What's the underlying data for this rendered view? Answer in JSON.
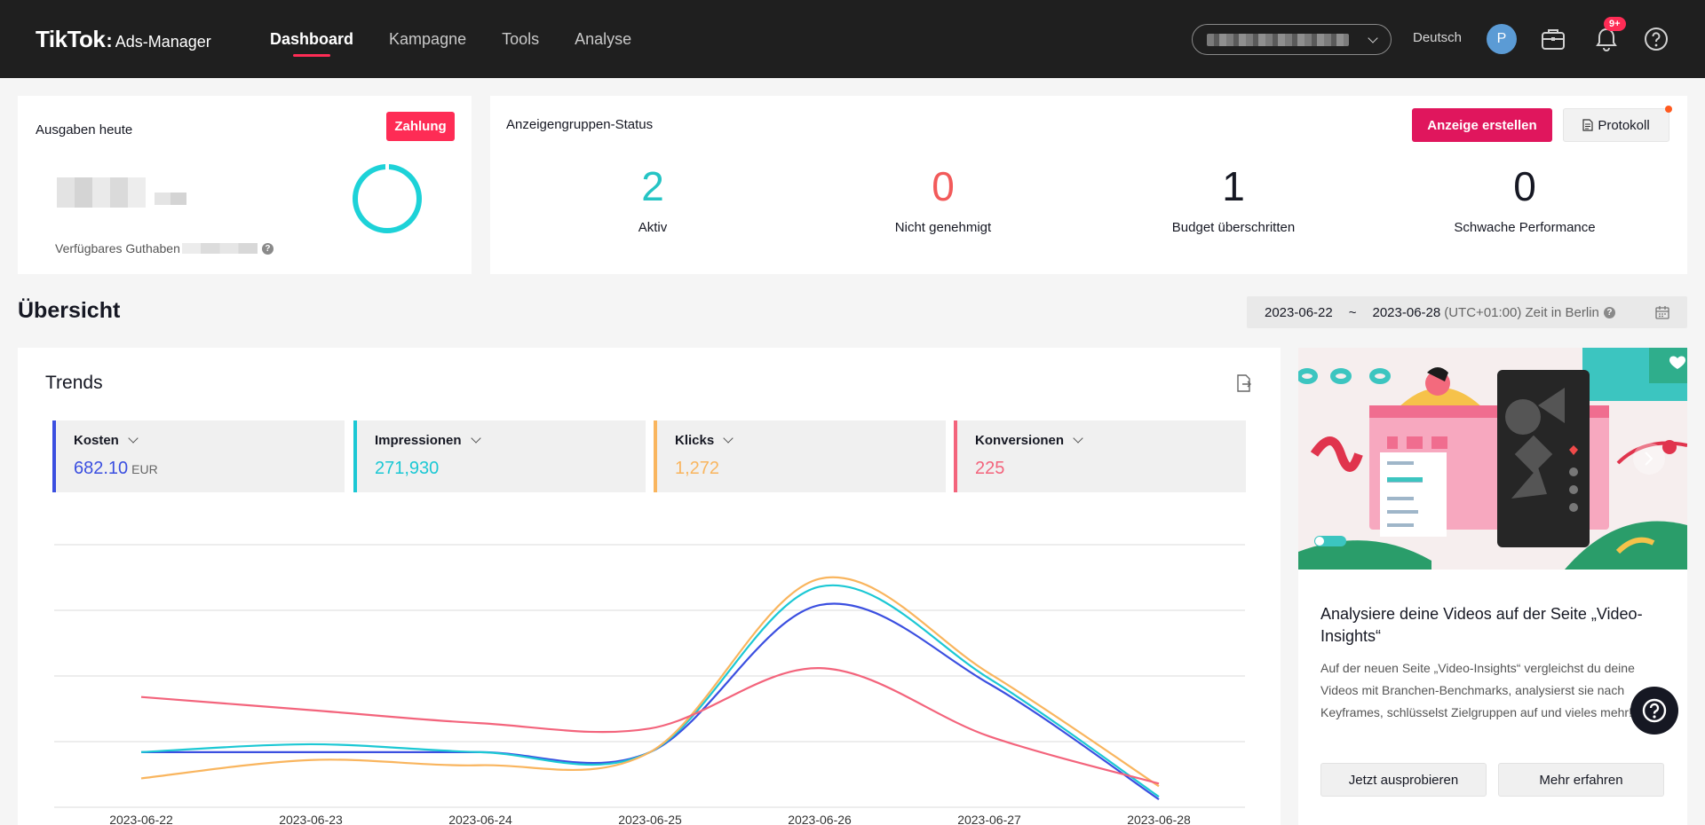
{
  "header": {
    "brand": "TikTok",
    "product": "Ads-Manager",
    "nav": [
      {
        "label": "Dashboard",
        "active": true
      },
      {
        "label": "Kampagne"
      },
      {
        "label": "Tools"
      },
      {
        "label": "Analyse"
      }
    ],
    "language": "Deutsch",
    "avatar_initial": "P",
    "notification_badge": "9+"
  },
  "spend": {
    "title": "Ausgaben heute",
    "pay_label": "Zahlung",
    "balance_label": "Verfügbares Guthaben",
    "help_glyph": "?"
  },
  "status": {
    "title": "Anzeigengruppen-Status",
    "create_label": "Anzeige erstellen",
    "log_label": "Protokoll",
    "stats": [
      {
        "value": "2",
        "label": "Aktiv",
        "color": "#25c4c4"
      },
      {
        "value": "0",
        "label": "Nicht genehmigt",
        "color": "#f25a5a"
      },
      {
        "value": "1",
        "label": "Budget überschritten",
        "color": "#161823"
      },
      {
        "value": "0",
        "label": "Schwache Performance",
        "color": "#161823"
      }
    ]
  },
  "overview": {
    "title": "Übersicht",
    "date_start": "2023-06-22",
    "date_sep": "~",
    "date_end": "2023-06-28",
    "timezone": "(UTC+01:00) Zeit in Berlin",
    "help_glyph": "?"
  },
  "trends": {
    "title": "Trends",
    "metrics": [
      {
        "label": "Kosten",
        "value": "682.10",
        "unit": "EUR",
        "color": "#3b4fe0"
      },
      {
        "label": "Impressionen",
        "value": "271,930",
        "unit": "",
        "color": "#1cc8d4"
      },
      {
        "label": "Klicks",
        "value": "1,272",
        "unit": "",
        "color": "#f9b55e"
      },
      {
        "label": "Konversionen",
        "value": "225",
        "unit": "",
        "color": "#f3647c"
      }
    ]
  },
  "chart_data": {
    "type": "line",
    "x": [
      "2023-06-22",
      "2023-06-23",
      "2023-06-24",
      "2023-06-25",
      "2023-06-26",
      "2023-06-27",
      "2023-06-28"
    ],
    "grid": true,
    "series": [
      {
        "name": "Kosten",
        "color": "#3b4fe0",
        "values": [
          0.21,
          0.21,
          0.21,
          0.21,
          0.77,
          0.47,
          0.03
        ]
      },
      {
        "name": "Impressionen",
        "color": "#1cc8d4",
        "values": [
          0.21,
          0.24,
          0.21,
          0.21,
          0.84,
          0.49,
          0.04
        ]
      },
      {
        "name": "Klicks",
        "color": "#f9b55e",
        "values": [
          0.11,
          0.18,
          0.16,
          0.21,
          0.87,
          0.51,
          0.08
        ]
      },
      {
        "name": "Konversionen",
        "color": "#f3647c",
        "values": [
          0.42,
          0.37,
          0.32,
          0.3,
          0.53,
          0.27,
          0.09
        ]
      }
    ]
  },
  "promo": {
    "title": "Analysiere deine Videos auf der Seite „Video-Insights“",
    "text": "Auf der neuen Seite „Video-Insights“ vergleichst du deine Videos mit Branchen-Benchmarks, analysierst sie nach Keyframes, schlüsselst Zielgruppen auf und vieles mehr!",
    "primary_label": "Jetzt ausprobieren",
    "secondary_label": "Mehr erfahren"
  },
  "help_fab_glyph": "?"
}
